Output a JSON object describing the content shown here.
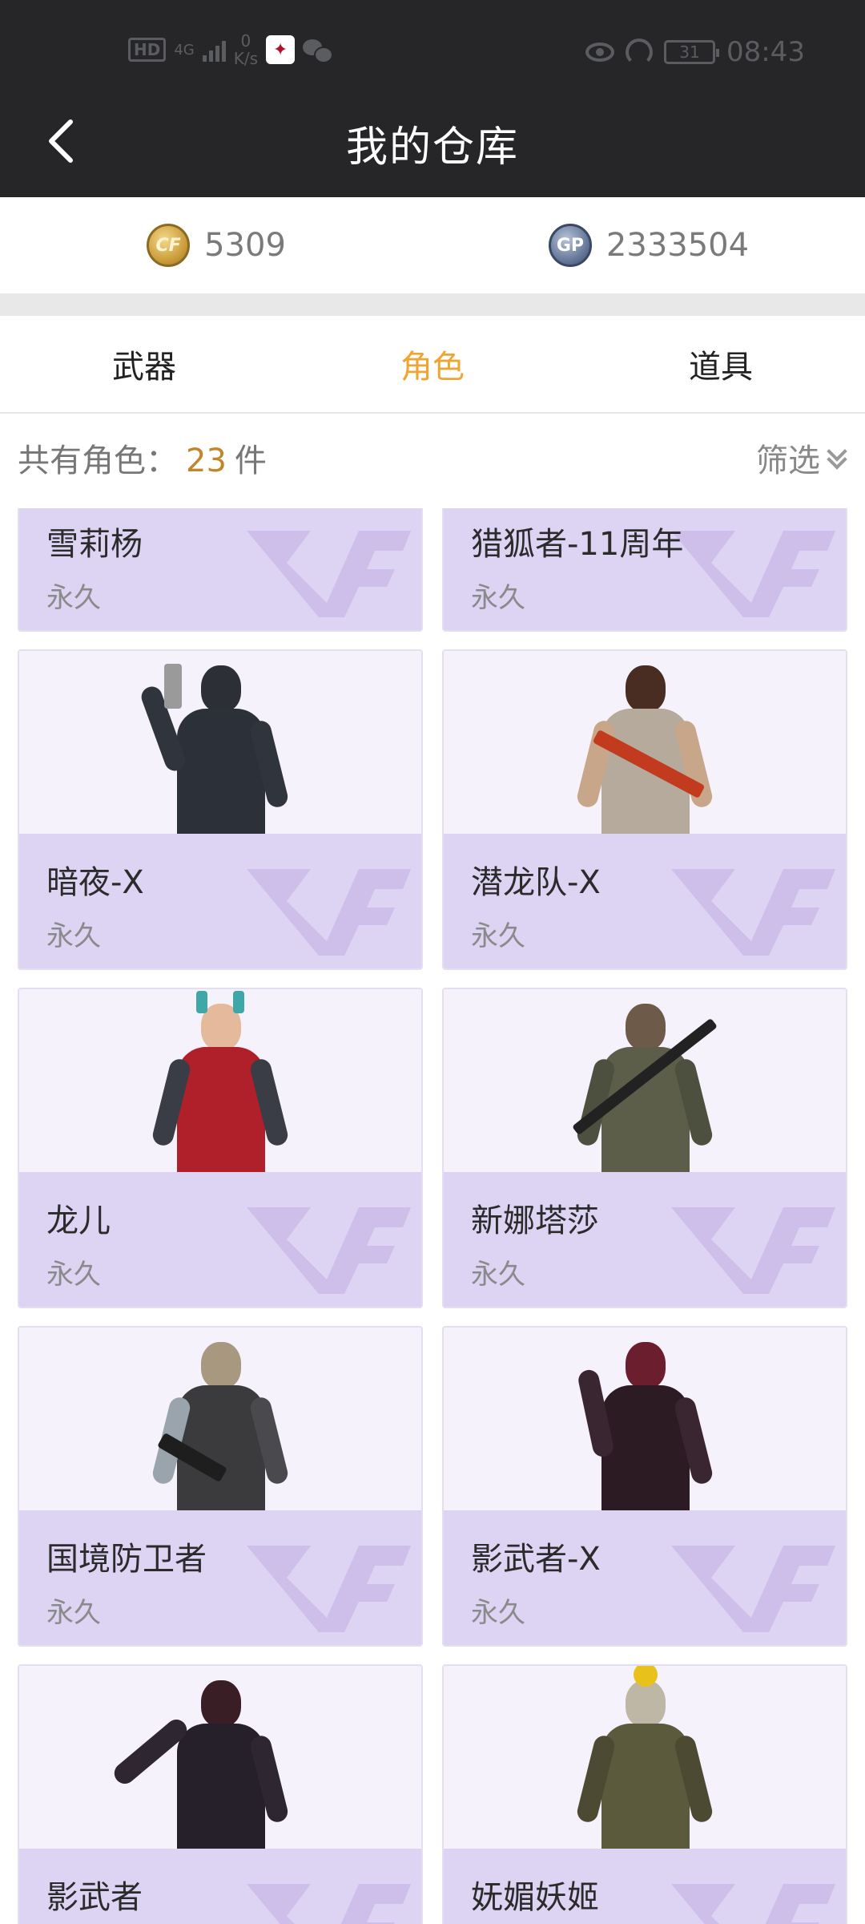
{
  "status_bar": {
    "hd": "HD",
    "network": "4G",
    "speed_value": "0",
    "speed_unit": "K/s",
    "battery": "31",
    "time": "08:43"
  },
  "header": {
    "title": "我的仓库"
  },
  "currency": {
    "cf_points": "5309",
    "gp_points": "2333504",
    "cf_icon_label": "CF",
    "gp_icon_label": "GP"
  },
  "tabs": [
    {
      "label": "武器",
      "active": false
    },
    {
      "label": "角色",
      "active": true
    },
    {
      "label": "道具",
      "active": false
    }
  ],
  "summary": {
    "prefix": "共有角色：",
    "count": "23",
    "suffix": "件",
    "filter_label": "筛选"
  },
  "colors": {
    "accent": "#f0a532",
    "count": "#c0862b",
    "card_info_bg": "#ddd3f3",
    "card_img_bg": "#f6f2fc",
    "header_bg": "#262628"
  },
  "characters": [
    {
      "name": "雪莉杨",
      "duration": "永久"
    },
    {
      "name": "猎狐者-11周年",
      "duration": "永久"
    },
    {
      "name": "暗夜-X",
      "duration": "永久"
    },
    {
      "name": "潜龙队-X",
      "duration": "永久"
    },
    {
      "name": "龙儿",
      "duration": "永久"
    },
    {
      "name": "新娜塔莎",
      "duration": "永久"
    },
    {
      "name": "国境防卫者",
      "duration": "永久"
    },
    {
      "name": "影武者-X",
      "duration": "永久"
    },
    {
      "name": "影武者",
      "duration": ""
    },
    {
      "name": "妩媚妖姬",
      "duration": ""
    }
  ]
}
